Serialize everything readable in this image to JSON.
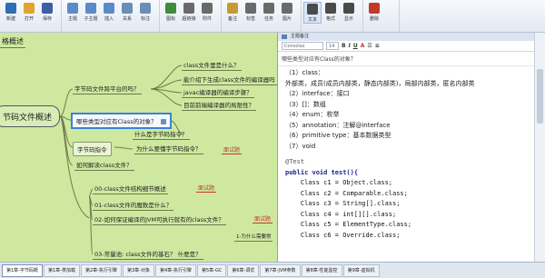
{
  "ribbon": {
    "groups": [
      {
        "label": "",
        "buttons": [
          {
            "label": "新建",
            "icon": "new-icon",
            "color": "#2f6db5"
          },
          {
            "label": "打开",
            "icon": "open-icon",
            "color": "#e0a52c"
          },
          {
            "label": "保存",
            "icon": "save-icon",
            "color": "#3b5fa3"
          }
        ]
      },
      {
        "label": "",
        "buttons": [
          {
            "label": "主题",
            "icon": "topic-icon",
            "color": "#5b8ac9"
          },
          {
            "label": "子主题",
            "icon": "subtopic-icon",
            "color": "#5b8ac9"
          },
          {
            "label": "插入",
            "icon": "insert-icon",
            "color": "#5b8ac9"
          },
          {
            "label": "关系",
            "icon": "relation-icon",
            "color": "#6a8fb7"
          },
          {
            "label": "标注",
            "icon": "callout-icon",
            "color": "#6a8fb7"
          }
        ]
      },
      {
        "label": "",
        "buttons": [
          {
            "label": "图标",
            "icon": "icon-icon",
            "color": "#3c8d3c"
          },
          {
            "label": "超链接",
            "icon": "link-icon",
            "color": "#6a6a6a"
          },
          {
            "label": "附件",
            "icon": "attach-icon",
            "color": "#6a6a6a"
          }
        ]
      },
      {
        "label": "",
        "buttons": [
          {
            "label": "备注",
            "icon": "note-icon",
            "color": "#c59a35"
          },
          {
            "label": "标签",
            "icon": "tag-icon",
            "color": "#6a6a6a"
          },
          {
            "label": "任务",
            "icon": "task-icon",
            "color": "#6a6a6a"
          },
          {
            "label": "图片",
            "icon": "image-icon",
            "color": "#6a6a6a"
          }
        ]
      },
      {
        "label": "",
        "buttons": [
          {
            "label": "文本",
            "icon": "text-icon",
            "color": "#4a4a4a"
          },
          {
            "label": "格式",
            "icon": "format-icon",
            "color": "#4a4a4a"
          },
          {
            "label": "显示",
            "icon": "show-icon",
            "color": "#4a4a4a"
          }
        ]
      },
      {
        "label": "",
        "buttons": [
          {
            "label": "删除",
            "icon": "delete-icon",
            "color": "#c0392b"
          }
        ]
      }
    ]
  },
  "mindmap": {
    "root": "节码文件概述",
    "left_title": "格概述",
    "topic1": "字节码文件跨平台的吗？",
    "topic1_children": [
      "class文件里是什么？",
      "能介绍下生成class文件的编译器吗",
      "javac编译器的编译步骤？",
      "目前前端编译器的局限性？"
    ],
    "topic2": "哪些类型对应有Class的对象？",
    "topic2_child": "什么是字节码指令？",
    "topic3": "字节码指令",
    "topic3_child": "为什么要懂字节码指令？",
    "topic3_tag": "面试题",
    "topic4": "如何解读class文件？",
    "lower_items": [
      "00-class文件结构细节概述",
      "01-class文件的魔数是什么？",
      "02-如何保证编译的JVM可执行就有的class文件？"
    ],
    "lower_tag1": "面试题",
    "lower_tag2": "面试题",
    "bottom_item": "03-常量池: class文件的基石？ 什麽是？",
    "bottom_side": "1-为什么需要常"
  },
  "editor": {
    "panel_title": "主题备注",
    "font_name": "Consolas",
    "font_size": "14",
    "heading": "哪些类型对应有Class的对象？",
    "lines": [
      "（1）class：",
      "外部类，成员(成员内部类，静态内部类)，局部内部类，匿名内部类",
      "（2）interface：接口",
      "（3）[]：数组",
      "（4）enum：枚举",
      "（5）annotation：注解@interface",
      "（6）primitive type：基本数据类型",
      "（7）void"
    ],
    "code": [
      "@Test",
      "public void test(){",
      "    Class c1 = Object.class;",
      "    Class c2 = Comparable.class;",
      "    Class c3 = String[].class;",
      "    Class c4 = int[][].class;",
      "    Class c5 = ElementType.class;",
      "    Class c6 = Override.class;"
    ]
  },
  "tabs": [
    "第1章-字节码概",
    "第1章-类加载",
    "第2章-执行引擎",
    "第3章-对象",
    "第4章-执行引擎",
    "第5章-GC",
    "第6章-调优",
    "第7章-JVM参数",
    "第8章-性能监控",
    "第9章-虚拟机"
  ]
}
